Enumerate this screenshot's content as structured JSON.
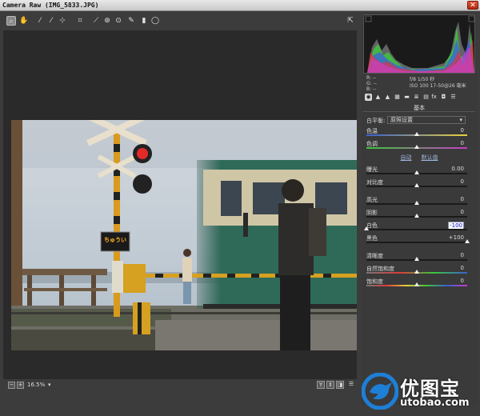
{
  "window": {
    "title": "Camera Raw (IMG_5833.JPG)",
    "close_label": "✕"
  },
  "toolbar": {
    "tools": [
      {
        "name": "zoom-tool-icon",
        "glyph": "🔍"
      },
      {
        "name": "hand-tool-icon",
        "glyph": "✋"
      },
      {
        "name": "white-balance-tool-icon",
        "glyph": "✒"
      },
      {
        "name": "color-sampler-tool-icon",
        "glyph": "✒"
      },
      {
        "name": "target-adjust-tool-icon",
        "glyph": "⊹"
      },
      {
        "name": "crop-tool-icon",
        "glyph": "⌗"
      },
      {
        "name": "straighten-tool-icon",
        "glyph": "⟋"
      },
      {
        "name": "spot-removal-tool-icon",
        "glyph": "⊛"
      },
      {
        "name": "red-eye-tool-icon",
        "glyph": "⊙"
      },
      {
        "name": "adjustment-brush-icon",
        "glyph": "✎"
      },
      {
        "name": "graduated-filter-icon",
        "glyph": "▮"
      },
      {
        "name": "radial-filter-icon",
        "glyph": "◯"
      }
    ],
    "open_prefs_glyph": "⇱"
  },
  "histogram_info": {
    "r_label": "R: --",
    "g_label": "G: --",
    "b_label": "B: --",
    "aperture_shutter": "f/8  1/50 秒",
    "iso_lens": "ISO 100  17-50@26 毫米"
  },
  "panel_tabs": [
    "◉",
    "▲",
    "▲",
    "▦",
    "▬",
    "≣",
    "▤",
    "fx",
    "◘",
    "☰"
  ],
  "basic": {
    "section_title": "基本",
    "white_balance_label": "白平衡:",
    "white_balance_value": "原照设置",
    "auto_label": "自动",
    "default_label": "默认值",
    "sliders": [
      {
        "label": "色温",
        "value": "0",
        "pos": 0.5,
        "track": "linear-gradient(90deg,#3a5fcf,#e8d23a)"
      },
      {
        "label": "色调",
        "value": "0",
        "pos": 0.5,
        "track": "linear-gradient(90deg,#3cc83c,#c83cc8)"
      },
      {
        "label": "曝光",
        "value": "0.00",
        "pos": 0.5,
        "track": "#1a1a1a",
        "gap": true
      },
      {
        "label": "对比度",
        "value": "0",
        "pos": 0.5,
        "track": "#1a1a1a"
      },
      {
        "label": "高光",
        "value": "0",
        "pos": 0.5,
        "track": "#1a1a1a",
        "gap": true
      },
      {
        "label": "阴影",
        "value": "0",
        "pos": 0.5,
        "track": "#1a1a1a"
      },
      {
        "label": "白色",
        "value": "-100",
        "pos": 0.0,
        "track": "#1a1a1a",
        "highlight": true
      },
      {
        "label": "黑色",
        "value": "+100",
        "pos": 1.0,
        "track": "#1a1a1a"
      },
      {
        "label": "清晰度",
        "value": "0",
        "pos": 0.5,
        "track": "#1a1a1a",
        "gap": true
      },
      {
        "label": "自然饱和度",
        "value": "0",
        "pos": 0.5,
        "track": "linear-gradient(90deg,#777,#e03a3a,#3ac83a,#3a5fcf)"
      },
      {
        "label": "饱和度",
        "value": "0",
        "pos": 0.5,
        "track": "linear-gradient(90deg,#777,#e03a3a,#e8d23a,#3ac83a,#3a5fcf,#c83cc8)"
      }
    ]
  },
  "bottombar": {
    "zoom_level": "16.5%",
    "zoom_out": "−",
    "zoom_in": "+",
    "arrow": "▾",
    "view_y": "Y",
    "view_a": "⇕",
    "view_b": "◨",
    "view_c": "☰"
  },
  "crossing_sign": "ちゅうい",
  "watermark": {
    "brand": "优图宝",
    "url": "utobao.com"
  },
  "colors": {
    "accent_link": "#9fb7e0",
    "watermark_blue": "#1e7fd6"
  }
}
